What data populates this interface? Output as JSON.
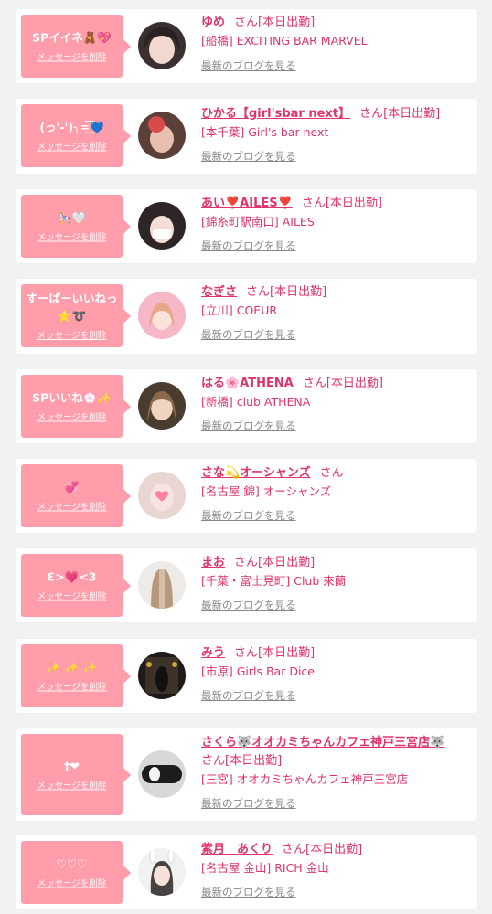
{
  "colors": {
    "accent": "#e2336b",
    "bubble": "#ff9dab",
    "card": "#ffffff",
    "background": "#f2f2f2",
    "link_gray": "#888888"
  },
  "entries": [
    {
      "message": "SPイイネ🧸💖",
      "delete_label": "メッセージを削除",
      "name": "ゆめ",
      "san": "さん",
      "work_status": "[本日出勤]",
      "shop": "[船橋] EXCITING BAR MARVEL",
      "blog_label": "最新のブログを見る"
    },
    {
      "message": "(っ'-')╮=͟͟͞͞💙",
      "delete_label": "メッセージを削除",
      "name": "ひかる【girl'sbar next】",
      "san": "さん",
      "work_status": "[本日出勤]",
      "shop": "[本千葉] Girl's bar next",
      "blog_label": "最新のブログを見る"
    },
    {
      "message": "🎠🤍",
      "delete_label": "メッセージを削除",
      "name": "あい❣️AILES❣️",
      "san": "さん",
      "work_status": "[本日出勤]",
      "shop": "[錦糸町駅南口] AILES",
      "blog_label": "最新のブログを見る"
    },
    {
      "message": "すーぱーいいねっ\n⭐️➰",
      "delete_label": "メッセージを削除",
      "name": "なぎさ",
      "san": "さん",
      "work_status": "[本日出勤]",
      "shop": "[立川] COEUR",
      "blog_label": "最新のブログを見る"
    },
    {
      "message": "SPいいね💮✨",
      "delete_label": "メッセージを削除",
      "name": "はる🌸ATHENA",
      "san": "さん",
      "work_status": "[本日出勤]",
      "shop": "[新橋] club ATHENA",
      "blog_label": "最新のブログを見る"
    },
    {
      "message": "💞",
      "delete_label": "メッセージを削除",
      "name": "さな💫オーシャンズ",
      "san": "さん",
      "work_status": "",
      "shop": "[名古屋 錦] オーシャンズ",
      "blog_label": "最新のブログを見る"
    },
    {
      "message": "Ɛ>💗<3",
      "delete_label": "メッセージを削除",
      "name": "まお",
      "san": "さん",
      "work_status": "[本日出勤]",
      "shop": "[千葉・富士見町] Club 來蘭",
      "blog_label": "最新のブログを見る"
    },
    {
      "message": "✨ ✨ ✨",
      "delete_label": "メッセージを削除",
      "name": "みう",
      "san": "さん",
      "work_status": "[本日出勤]",
      "shop": "[市原] Girls Bar Dice",
      "blog_label": "最新のブログを見る"
    },
    {
      "message": "†❤",
      "delete_label": "メッセージを削除",
      "name": "さくら🐺オオカミちゃんカフェ神戸三宮店🐺",
      "san": "さん",
      "work_status": "[本日出勤]",
      "shop": "[三宮] オオカミちゃんカフェ神戸三宮店",
      "blog_label": "最新のブログを見る"
    },
    {
      "message": "♡♡♡",
      "delete_label": "メッセージを削除",
      "name": "紫月　あくり",
      "san": "さん",
      "work_status": "[本日出勤]",
      "shop": "[名古屋 金山] RICH 金山",
      "blog_label": "最新のブログを見る"
    }
  ]
}
